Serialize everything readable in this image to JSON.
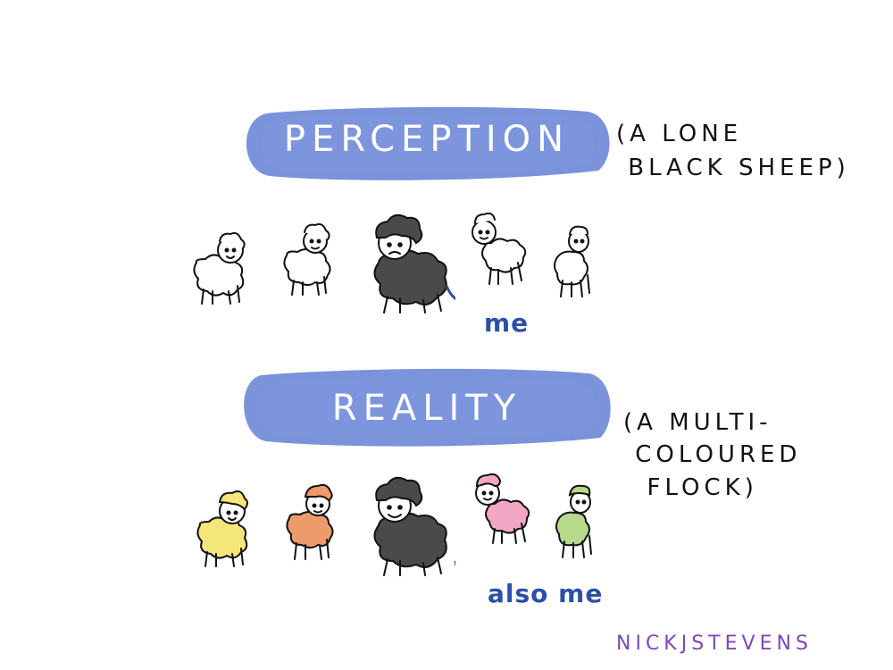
{
  "perception": {
    "title": "PERCEPTION",
    "note_lines": "(A LONE\n BLACK SHEEP)",
    "callout": "me",
    "banner_color": "#6f8ad8",
    "sheep": [
      "white-sheep",
      "white-sheep",
      "black-sheep",
      "white-sheep",
      "white-sheep"
    ]
  },
  "reality": {
    "title": "REALITY",
    "note_lines": "(A MULTI-\n COLOURED\n  FLOCK)",
    "callout": "also me",
    "banner_color": "#6f8ad8",
    "sheep": [
      "yellow-sheep",
      "orange-sheep",
      "black-sheep",
      "pink-sheep",
      "green-sheep"
    ]
  },
  "signature": "NICKJSTEVENS",
  "colors": {
    "white": "#ffffff",
    "black": "#4a4a4a",
    "yellow": "#f5e67a",
    "orange": "#ef9a6a",
    "pink": "#f2a7c4",
    "green": "#b6d98a",
    "accent_blue": "#2c4fa8",
    "signature_purple": "#7b49b6"
  }
}
